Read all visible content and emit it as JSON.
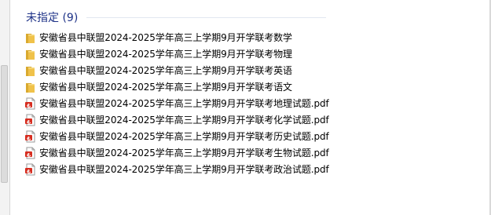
{
  "group": {
    "title": "未指定 (9)"
  },
  "files": [
    {
      "name": "安徽省县中联盟2024-2025学年高三上学期9月开学联考数学",
      "type": "folder"
    },
    {
      "name": "安徽省县中联盟2024-2025学年高三上学期9月开学联考物理",
      "type": "folder"
    },
    {
      "name": "安徽省县中联盟2024-2025学年高三上学期9月开学联考英语",
      "type": "folder"
    },
    {
      "name": "安徽省县中联盟2024-2025学年高三上学期9月开学联考语文",
      "type": "folder"
    },
    {
      "name": "安徽省县中联盟2024-2025学年高三上学期9月开学联考地理试题.pdf",
      "type": "pdf"
    },
    {
      "name": "安徽省县中联盟2024-2025学年高三上学期9月开学联考化学试题.pdf",
      "type": "pdf"
    },
    {
      "name": "安徽省县中联盟2024-2025学年高三上学期9月开学联考历史试题.pdf",
      "type": "pdf"
    },
    {
      "name": "安徽省县中联盟2024-2025学年高三上学期9月开学联考生物试题.pdf",
      "type": "pdf"
    },
    {
      "name": "安徽省县中联盟2024-2025学年高三上学期9月开学联考政治试题.pdf",
      "type": "pdf"
    }
  ],
  "colors": {
    "group_title": "#1e3287",
    "folder": "#f0c24a",
    "pdf": "#d62d20"
  },
  "icons": {
    "folder": "folder-icon",
    "pdf": "pdf-file-icon"
  }
}
